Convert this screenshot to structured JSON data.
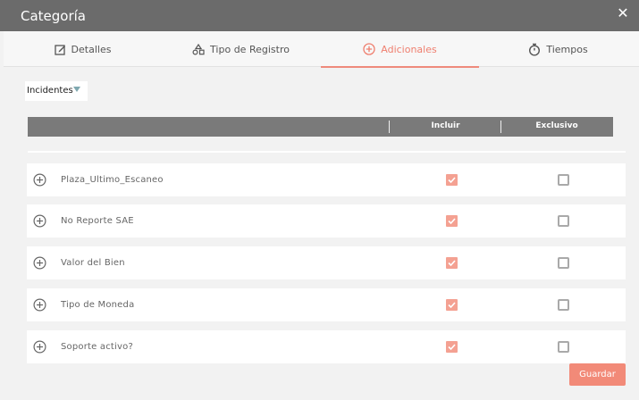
{
  "window": {
    "title": "Categoría"
  },
  "tabs": [
    {
      "label": "Detalles",
      "icon": "edit-icon",
      "active": false
    },
    {
      "label": "Tipo de Registro",
      "icon": "shapes-icon",
      "active": false
    },
    {
      "label": "Adicionales",
      "icon": "plus-circle-icon",
      "active": true
    },
    {
      "label": "Tiempos",
      "icon": "stopwatch-icon",
      "active": false
    }
  ],
  "filter": {
    "selected": "Incidentes"
  },
  "table": {
    "headers": {
      "include": "Incluir",
      "exclusive": "Exclusivo"
    },
    "rows": [
      {
        "name": "Plaza_Ultimo_Escaneo",
        "include": true,
        "exclusive": false
      },
      {
        "name": "No Reporte SAE",
        "include": true,
        "exclusive": false
      },
      {
        "name": "Valor del Bien",
        "include": true,
        "exclusive": false
      },
      {
        "name": "Tipo de Moneda",
        "include": true,
        "exclusive": false
      },
      {
        "name": "Soporte activo?",
        "include": true,
        "exclusive": false
      }
    ]
  },
  "actions": {
    "save_label": "Guardar"
  },
  "colors": {
    "accent": "#f28a78",
    "titlebar": "#6b6b6b",
    "header": "#7a7a7a"
  }
}
